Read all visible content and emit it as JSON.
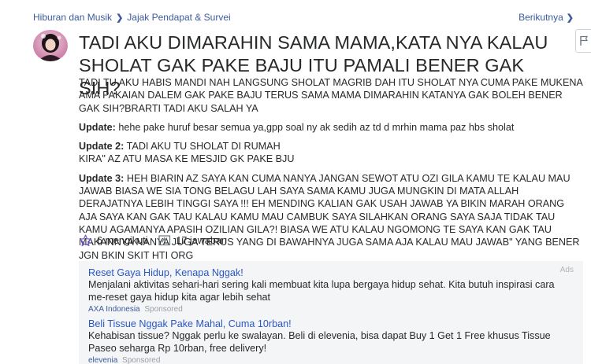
{
  "breadcrumb": {
    "category": "Hiburan dan Musik",
    "subcategory": "Jajak Pendapat & Survei",
    "next_label": "Berikutnya"
  },
  "question": {
    "title": "TADI AKU DIMARAHIN SAMA MAMA,KATA NYA KALAU SHOLAT GAK PAKE BAJU ITU PAMALI BENER GAK SIH?",
    "details": "TADI TU AKU HABIS MANDI NAH LANGSUNG SHOLAT MAGRIB DAH ITU SHOLAT NYA CUMA PAKE MUKENA AMA PAKAIAN DALEM GAK PAKE BAJU TERUS SAMA MAMA DIMARAHIN KATANYA GAK BOLEH BENER GAK SIH?BRARTI TADI AKU SALAH YA",
    "updates": [
      {
        "label": "Update:",
        "text": "hehe pake huruf besar semua ya,gpp soal ny ak sedih az td d mrhin mama paz hbs sholat"
      },
      {
        "label": "Update 2:",
        "text": "TADI AKU TU SHOLAT DI RUMAH",
        "text2": "KIRA\" AZ ATU MASA KE MESJID GK PAKE BJU"
      },
      {
        "label": "Update 3:",
        "text": "HEH BIARIN AZ SAYA KAN CUMA NANYA JANGAN SEWOT ATU OZI GILA KAMU TE KALAU MAU JAWAB BIASA WE SIA TONG BELAGU LAH SAYA SAMA KAMU JUGA MUNGKIN DI MATA ALLAH DERAJATNYA LEBIH TINGGI SAYA !!! EH MENDING KALIAN GAK USAH JAWAB YA BIKIN MARAH ORANG AJA SAYA KAN GAK TAU KALAU KAMU MAU CAMBUK SAYA SILAHKAN ORANG SAYA SAJA TIDAK TAU KAMU AGAMANYA APASIH OZILIAN GILA?! BIASA WE ATU KALAU NGOMONG TE SAYA KAN GAK TAU MAKANNYA NANYA JUGA TERUS YANG DI BAWAHNYA JUGA SAMA AJA KALAU MAU JAWAB\" YANG BENER JGN BKIN SKIT HTI ORG"
      }
    ],
    "follow_label": "6 mengikuti",
    "answers_label": "17 jawaban"
  },
  "ads": {
    "label": "Ads",
    "items": [
      {
        "title": "Reset Gaya Hidup, Kenapa Nggak!",
        "text": "Menjalani aktivitas sehari-hari sering kali membuat kita lupa bergaya hidup sehat. Kita butuh inspirasi cara me-reset gaya hidup kita agar lebih sehat",
        "source": "AXA Indonesia",
        "sponsored": "Sponsored"
      },
      {
        "title": "Beli Tissue Nggak Pake Mahal, Cuma 10rban!",
        "text": "Kehabisan tissue? Nggak perlu ke swalayan. Beli di elevenia, bisa dapat Buy 1 Get 1 Free khusus Tissue Paseo seharga Rp 10rban, free delivery!",
        "source": "elevenia",
        "sponsored": "Sponsored"
      }
    ]
  },
  "icons": {
    "follow": "star-outline-icon",
    "answers": "answer-icon",
    "flag": "flag-icon",
    "chevron": "chevron-right-icon"
  },
  "colors": {
    "link": "#3d5a99",
    "ad_title": "#2b57c2",
    "follow_star": "#7b5cd6",
    "ad_background": "#f4f5f7"
  }
}
